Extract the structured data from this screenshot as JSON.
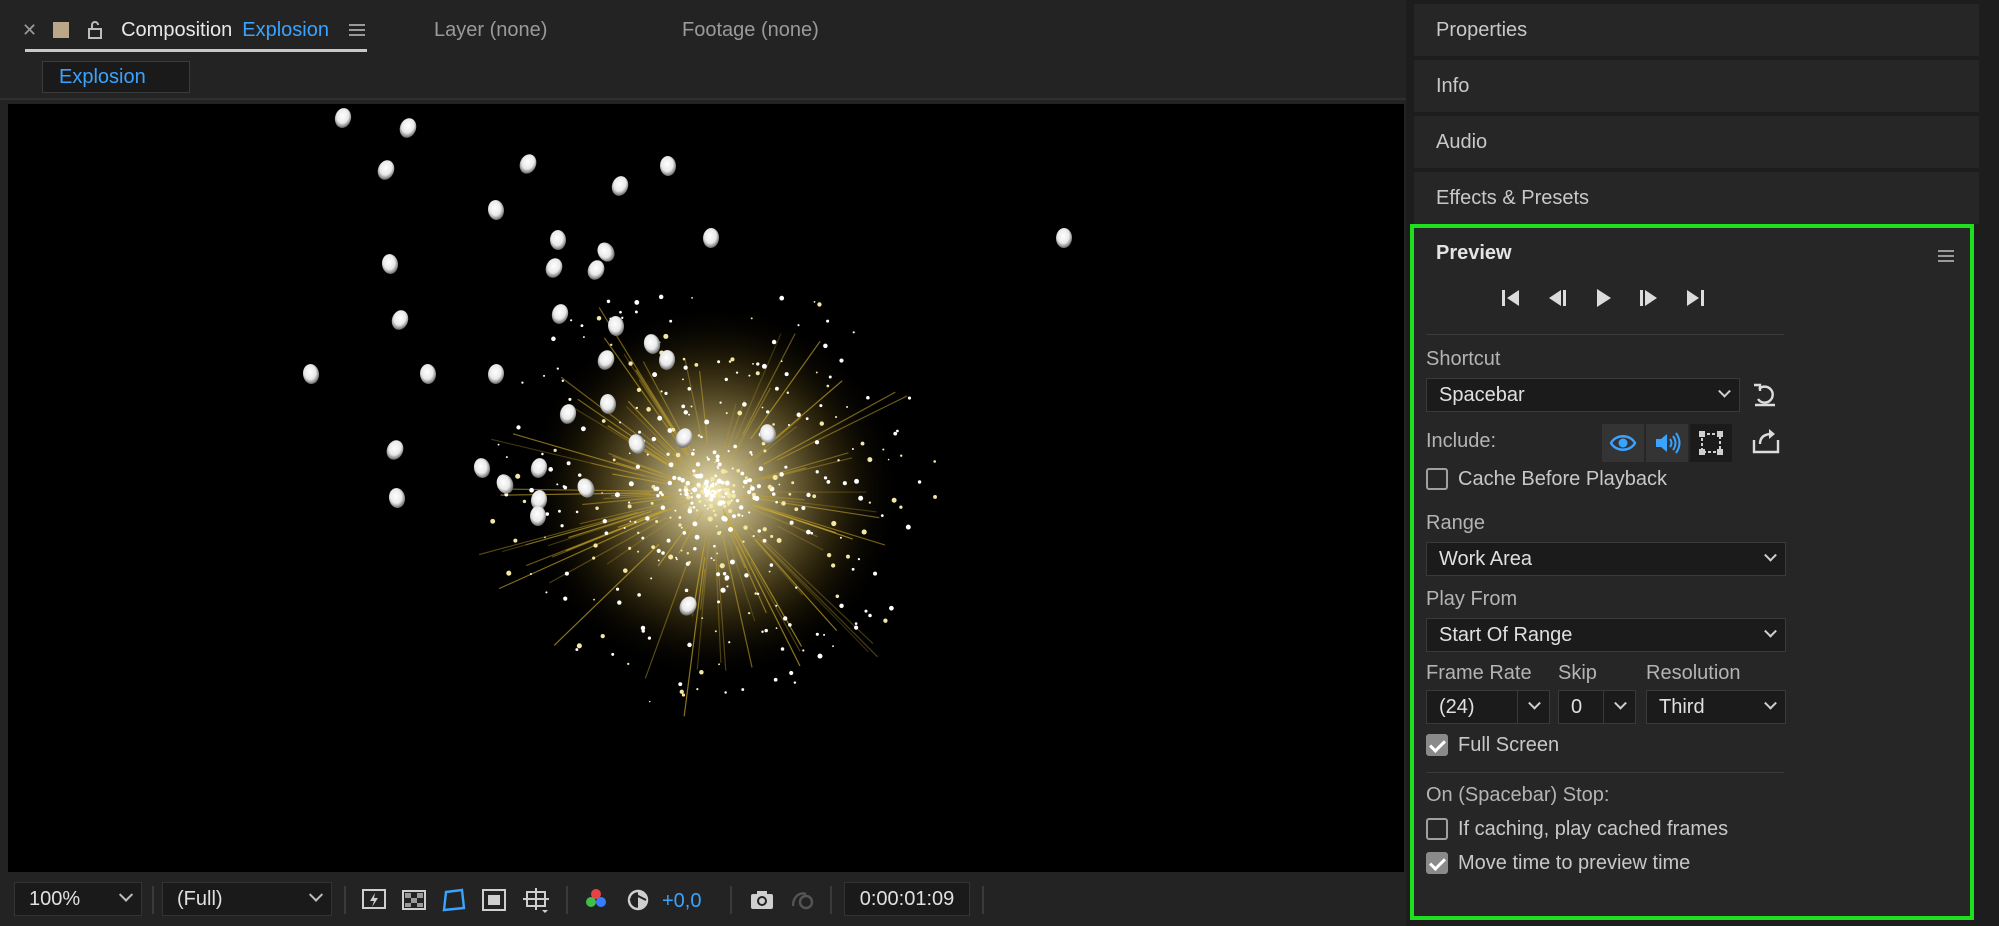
{
  "composition_panel": {
    "tab": {
      "prefix": "Composition",
      "name": "Explosion"
    },
    "other_tabs": [
      "Layer (none)",
      "Footage (none)"
    ],
    "flowchart_chip": "Explosion",
    "toolbar": {
      "magnification": "100%",
      "resolution": "(Full)",
      "exposure": "+0,0",
      "timecode": "0:00:01:09"
    }
  },
  "right_panels": {
    "collapsed": [
      "Properties",
      "Info",
      "Audio",
      "Effects & Presets"
    ]
  },
  "preview": {
    "title": "Preview",
    "shortcut_label": "Shortcut",
    "shortcut_value": "Spacebar",
    "include_label": "Include:",
    "cache_before_playback": {
      "label": "Cache Before Playback",
      "checked": false
    },
    "range_label": "Range",
    "range_value": "Work Area",
    "play_from_label": "Play From",
    "play_from_value": "Start Of Range",
    "frame_rate_label": "Frame Rate",
    "frame_rate_value": "(24)",
    "skip_label": "Skip",
    "skip_value": "0",
    "resolution_label": "Resolution",
    "resolution_value": "Third",
    "full_screen": {
      "label": "Full Screen",
      "checked": true
    },
    "stop_label": "On (Spacebar) Stop:",
    "if_caching": {
      "label": "If caching, play cached frames",
      "checked": false
    },
    "move_time": {
      "label": "Move time to preview time",
      "checked": true
    }
  },
  "colors": {
    "accent_blue": "#3aa3ff",
    "highlight_green": "#1ee01e",
    "panel_bg": "#262626",
    "viewer_bg": "#000000"
  }
}
